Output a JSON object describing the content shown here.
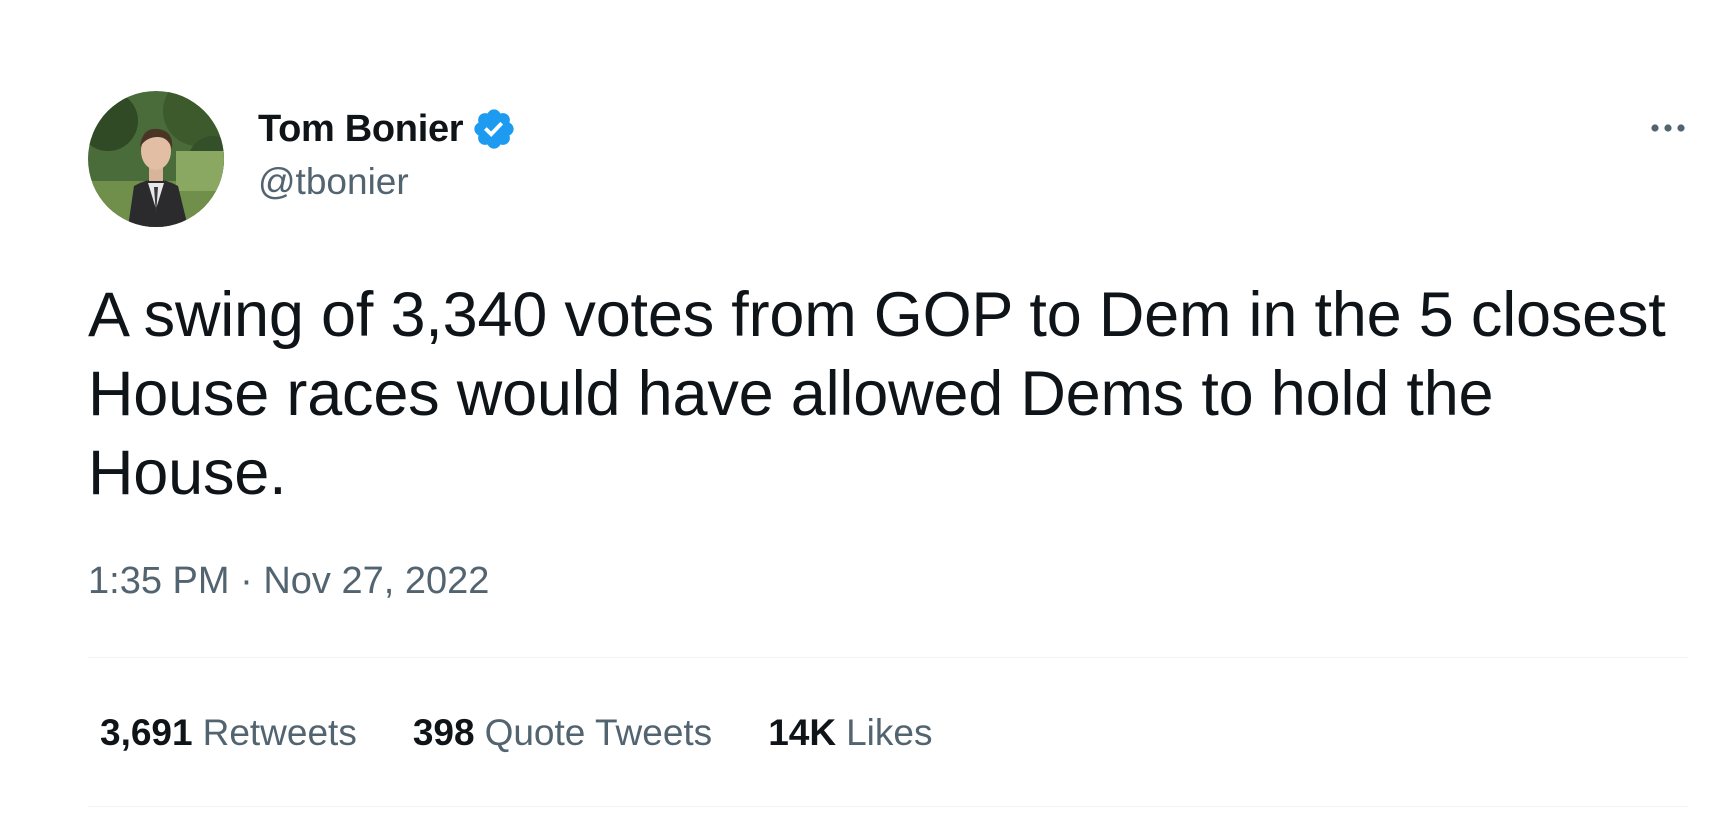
{
  "author": {
    "display_name": "Tom Bonier",
    "handle": "@tbonier",
    "verified": true,
    "verified_color": "#1d9bf0"
  },
  "tweet": {
    "text": "A swing of 3,340 votes from GOP to Dem in the 5 closest House races would have allowed Dems to hold the House.",
    "time": "1:35 PM",
    "separator": "·",
    "date": "Nov 27, 2022"
  },
  "stats": [
    {
      "count": "3,691",
      "label": "Retweets"
    },
    {
      "count": "398",
      "label": "Quote Tweets"
    },
    {
      "count": "14K",
      "label": "Likes"
    }
  ],
  "icons": {
    "more": "more-options-icon",
    "verified": "verified-badge-icon"
  },
  "colors": {
    "text_primary": "#0f1419",
    "text_secondary": "#536471",
    "divider": "#eff3f4"
  }
}
